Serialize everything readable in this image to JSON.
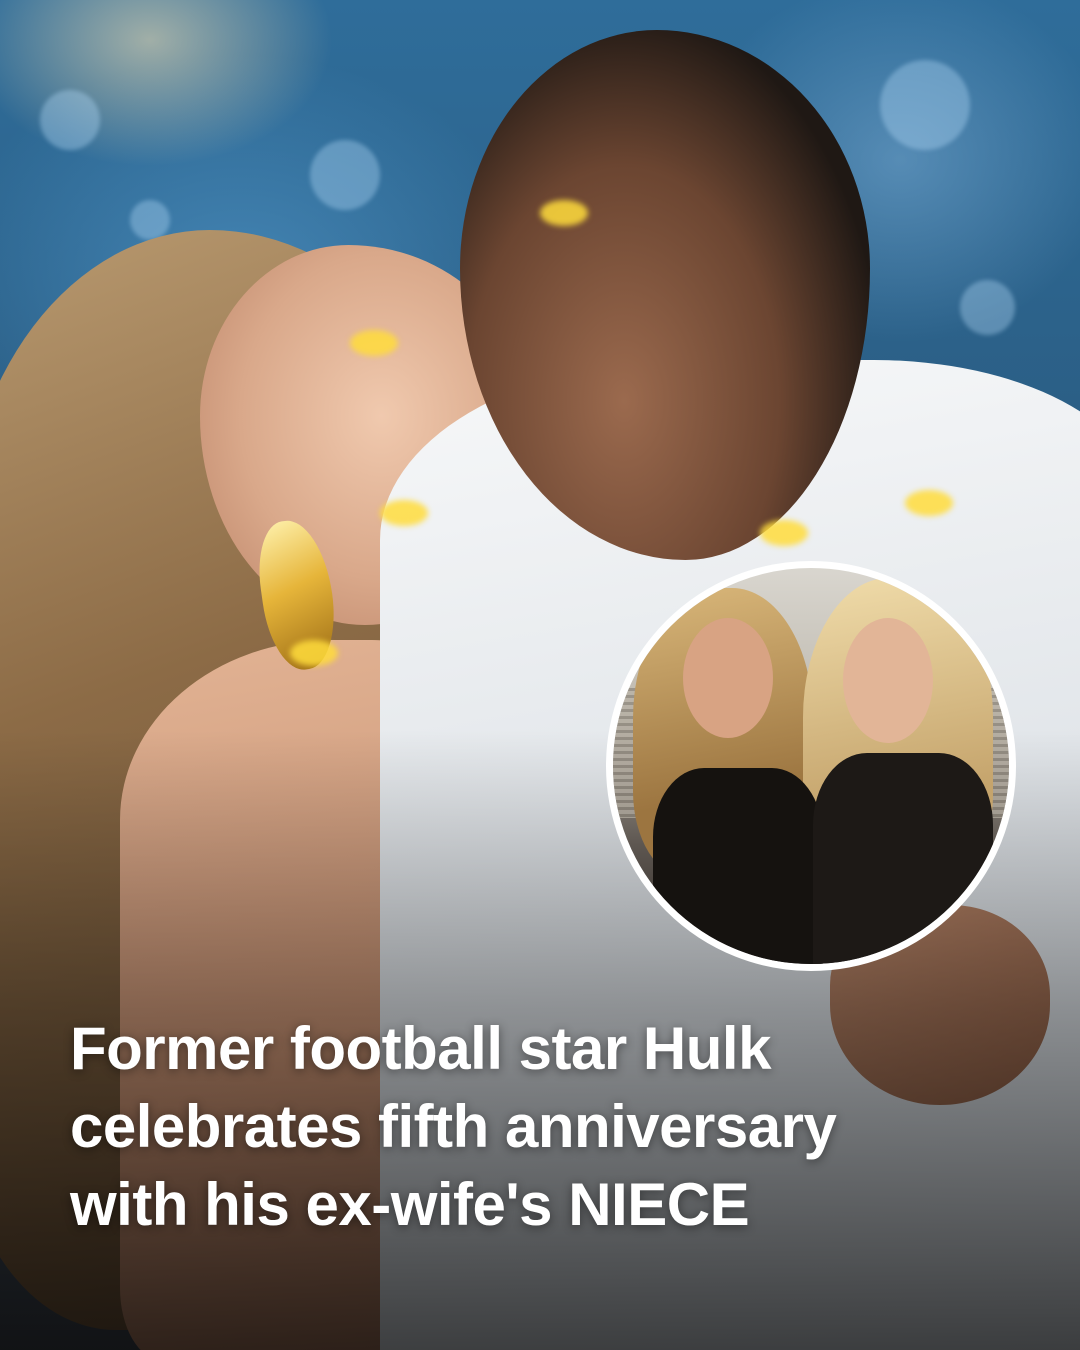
{
  "headline": {
    "lines": [
      "Former football star Hulk",
      "celebrates fifth anniversary",
      "with his ex-wife's NIECE"
    ]
  },
  "images": {
    "main_photo": "couple-kissing-photo",
    "inset_photo": "two-women-inset-photo"
  },
  "colors": {
    "headline_text": "#ffffff",
    "inset_border": "#ffffff"
  }
}
